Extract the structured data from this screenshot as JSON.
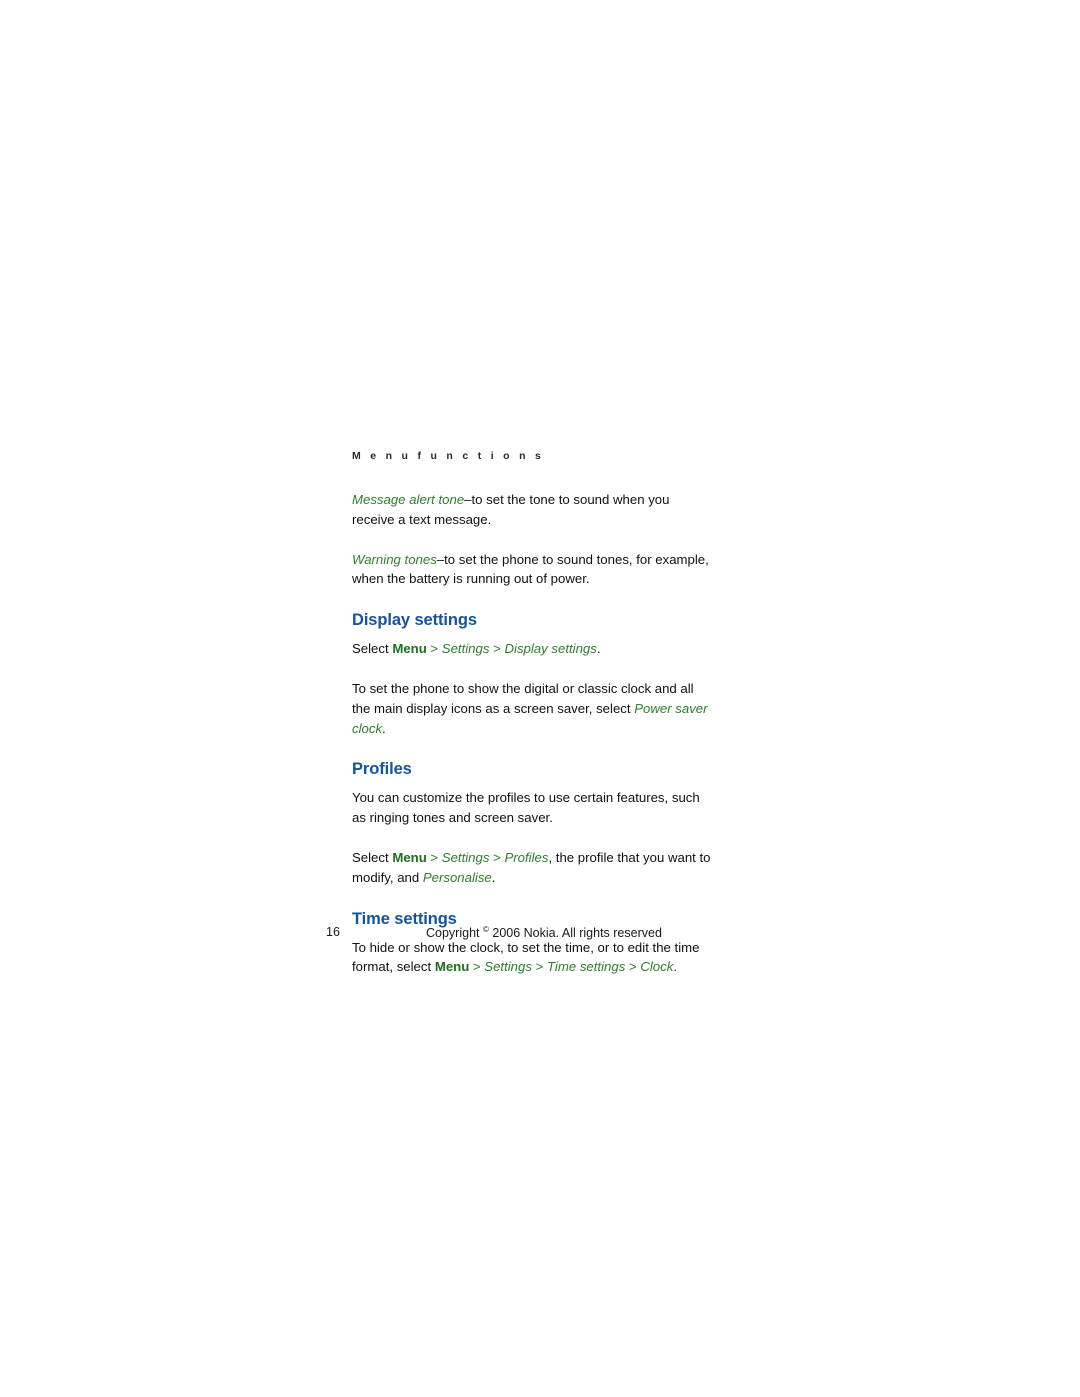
{
  "document": {
    "running_head": "M e n u   f u n c t i o n s",
    "running_head_plain": "Menu functions"
  },
  "colors": {
    "heading_blue": "#15539E",
    "accent_green": "#2D7F2D",
    "body_black": "#111111",
    "page_background": "#FFFFFF"
  },
  "intro": {
    "para1": {
      "term": "Message alert tone",
      "dash": "–",
      "rest": "to set the tone to sound when you receive a text message."
    },
    "para2": {
      "term": "Warning tones",
      "dash": "–",
      "rest": "to set the phone to sound tones, for example, when the battery is running out of power."
    }
  },
  "sections": [
    {
      "id": "display-settings",
      "heading": "Display settings",
      "path_line": {
        "lead": "Select ",
        "menu": "Menu",
        "sep1": " > ",
        "item1": "Settings",
        "sep2": " > ",
        "item2": "Display settings",
        "end": "."
      },
      "body": {
        "pre": "To set the phone to show the digital or classic clock and all the main display icons as a screen saver, select ",
        "term": "Power saver clock",
        "post": "."
      }
    },
    {
      "id": "profiles",
      "heading": "Profiles",
      "body": "You can customize the profiles to use certain features, such as ringing tones and screen saver.",
      "path_line": {
        "lead": "Select ",
        "menu": "Menu",
        "sep1": " > ",
        "item1": "Settings",
        "sep2": " > ",
        "item2": "Profiles",
        "mid": ", the profile that you want to modify, and ",
        "item3": "Personalise",
        "end": "."
      }
    },
    {
      "id": "time-settings",
      "heading": "Time settings",
      "body": {
        "pre": "To hide or show the clock, to set the time, or to edit the time format, select ",
        "menu": "Menu",
        "sep1": " > ",
        "item1": "Settings",
        "sep2": " > ",
        "item2": "Time settings",
        "sep3": " > ",
        "item3": "Clock",
        "end": "."
      }
    }
  ],
  "footer": {
    "page_number": "16",
    "copyright_pre": "Copyright ",
    "copyright_symbol": "©",
    "copyright_post": " 2006 Nokia. All rights reserved"
  }
}
